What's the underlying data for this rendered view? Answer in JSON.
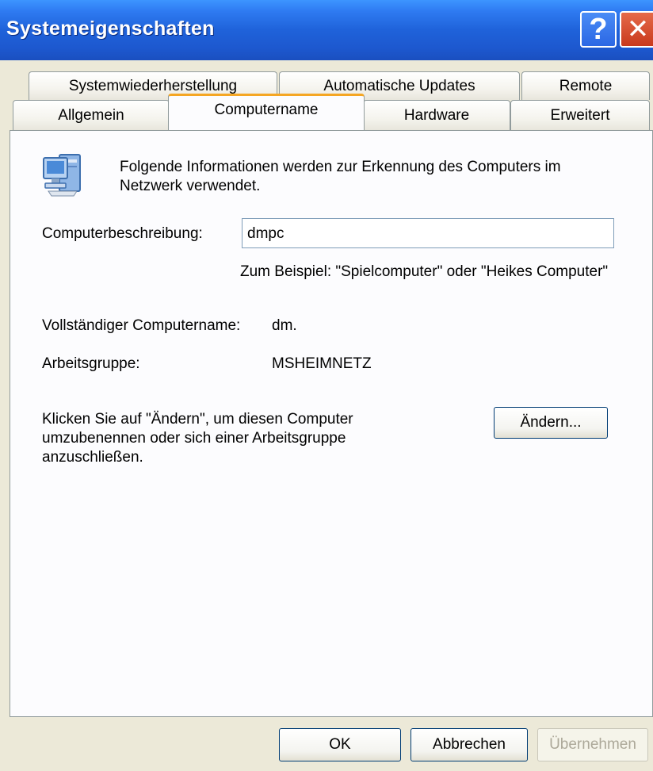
{
  "window": {
    "title": "Systemeigenschaften",
    "help_label": "?",
    "close_label": "✕"
  },
  "tabs": {
    "row1": [
      {
        "label": "Systemwiederherstellung"
      },
      {
        "label": "Automatische Updates"
      },
      {
        "label": "Remote"
      }
    ],
    "row2": [
      {
        "label": "Allgemein"
      },
      {
        "label": "Computername"
      },
      {
        "label": "Hardware"
      },
      {
        "label": "Erweitert"
      }
    ],
    "active": "Computername"
  },
  "panel": {
    "info_text": "Folgende Informationen werden zur Erkennung des Computers im Netzwerk verwendet.",
    "icon": "computer-network-icon",
    "description_label": "Computerbeschreibung:",
    "description_value": "dmpc",
    "example_text": "Zum Beispiel: \"Spielcomputer\" oder \"Heikes Computer\"",
    "fullname_label": "Vollständiger Computername:",
    "fullname_value": "dm.",
    "workgroup_label": "Arbeitsgruppe:",
    "workgroup_value": "MSHEIMNETZ",
    "change_text": "Klicken Sie auf \"Ändern\", um diesen Computer umzubenennen oder sich einer Arbeitsgruppe anzuschließen.",
    "change_button": "Ändern..."
  },
  "footer": {
    "ok": "OK",
    "cancel": "Abbrechen",
    "apply": "Übernehmen"
  },
  "colors": {
    "titlebar": "#1f62da",
    "tab_highlight": "#f5a623",
    "dialog_bg": "#ece9d8"
  }
}
